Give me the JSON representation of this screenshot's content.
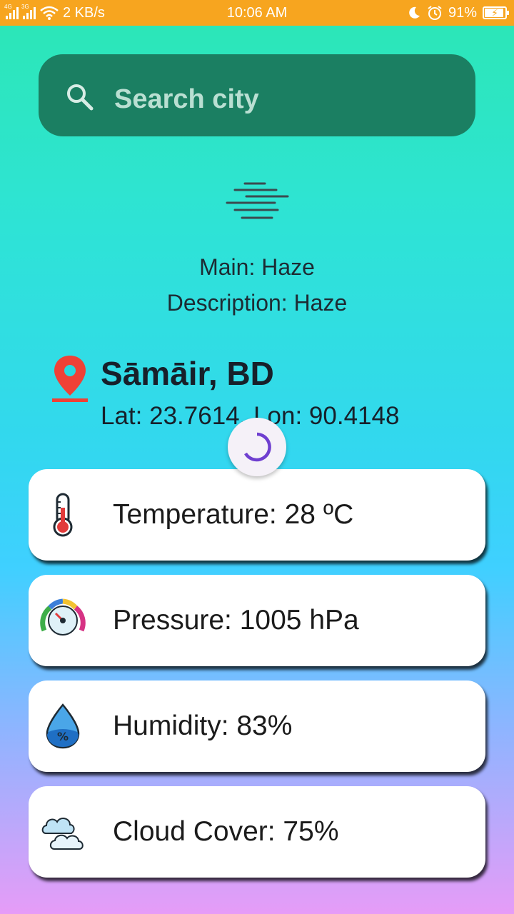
{
  "status_bar": {
    "network_1": "4G",
    "network_2": "3G",
    "speed": "2 KB/s",
    "time": "10:06 AM",
    "battery": "91%",
    "color": "#f7a51f"
  },
  "search": {
    "placeholder": "Search city",
    "icon": "search-icon"
  },
  "weather": {
    "icon": "haze-icon",
    "main": "Main: Haze",
    "description": "Description: Haze"
  },
  "location": {
    "icon": "location-pin-icon",
    "city": "Sāmāir, BD",
    "coords": "Lat: 23.7614, Lon: 90.4148"
  },
  "loading": {
    "icon": "loading-spinner-icon"
  },
  "cards": [
    {
      "icon": "thermometer-icon",
      "label": "Temperature: 28 ºC"
    },
    {
      "icon": "pressure-gauge-icon",
      "label": "Pressure: 1005 hPa"
    },
    {
      "icon": "humidity-drop-icon",
      "label": "Humidity: 83%"
    },
    {
      "icon": "clouds-icon",
      "label": "Cloud Cover: 75%"
    }
  ]
}
